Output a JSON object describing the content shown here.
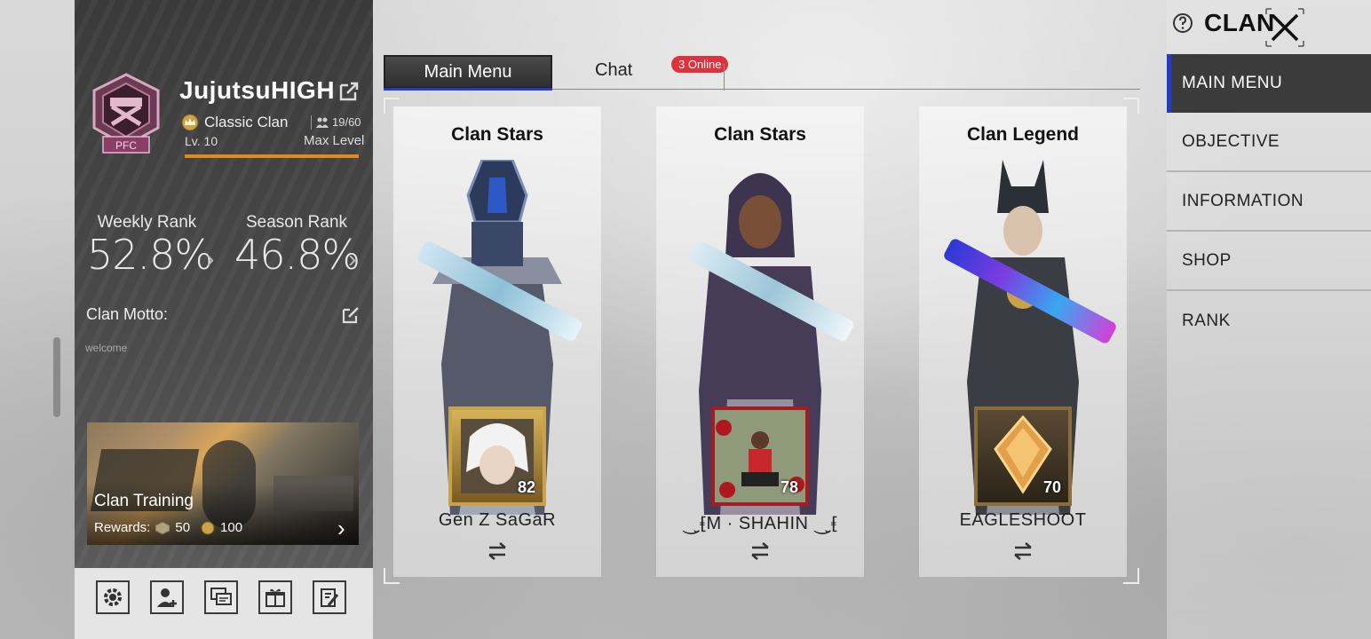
{
  "clan": {
    "name": "JujutsuHIGH",
    "emblem_tag": "PFC",
    "type": "Classic Clan",
    "members": "19/60",
    "level": "Lv. 10",
    "level_status": "Max Level",
    "level_progress": 1.0
  },
  "ranks": {
    "weekly_label": "Weekly Rank",
    "weekly_value": "52.8%",
    "season_label": "Season Rank",
    "season_value": "46.8%"
  },
  "motto": {
    "label": "Clan Motto:",
    "text": "welcome"
  },
  "training": {
    "title": "Clan Training",
    "rewards_label": "Rewards:",
    "reward_1": "50",
    "reward_2": "100"
  },
  "tabs": {
    "main_menu": "Main Menu",
    "chat": "Chat",
    "online_badge": "3 Online"
  },
  "cards": [
    {
      "title": "Clan Stars",
      "name": "Gen Z SaGaR",
      "level": "82"
    },
    {
      "title": "Clan Stars",
      "name": "⏝̮⹗M · SHAHIN ⏝̮⹗",
      "level": "78"
    },
    {
      "title": "Clan Legend",
      "name": "EAGLESHOOT",
      "level": "70"
    }
  ],
  "header": {
    "title": "CLAN"
  },
  "nav": {
    "items": [
      "MAIN MENU",
      "OBJECTIVE",
      "INFORMATION",
      "SHOP",
      "RANK"
    ]
  },
  "colors": {
    "accent_blue": "#1f3dc9",
    "badge_red": "#e0323d",
    "level_bar": "#e38a1e"
  }
}
